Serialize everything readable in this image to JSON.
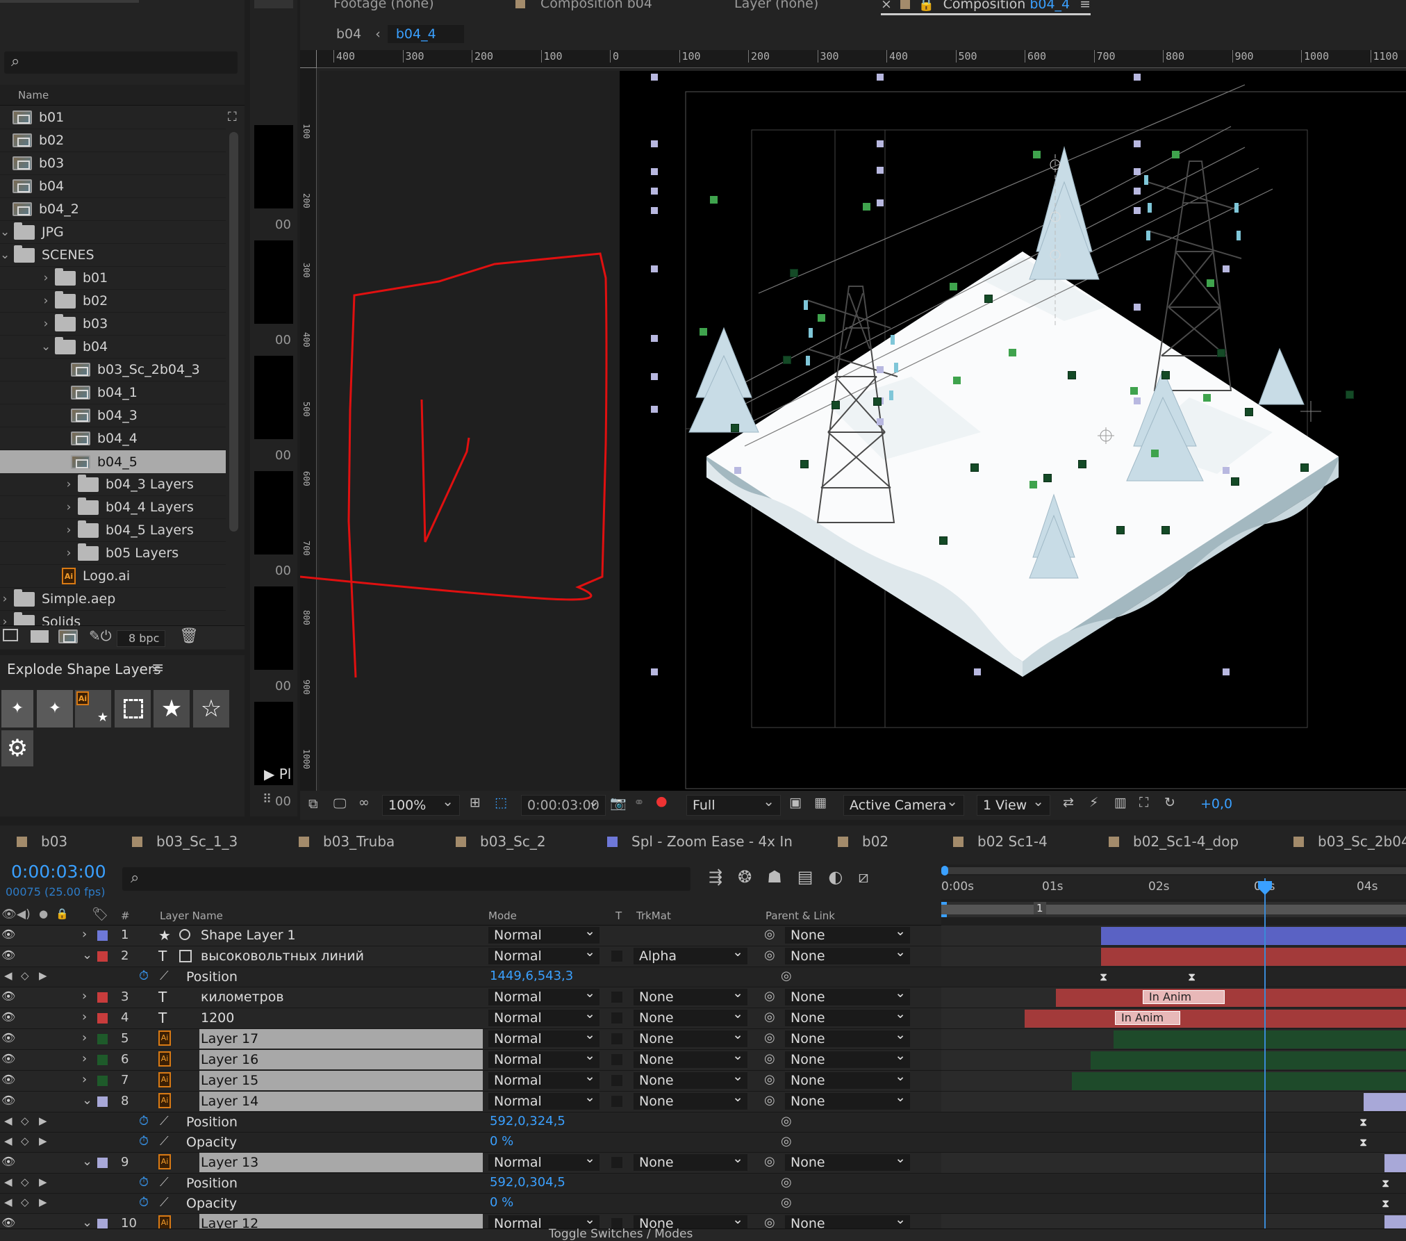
{
  "viewer_tabs": {
    "footage": "Footage (none)",
    "composition_prefix": "Composition",
    "composition_b04": "b04",
    "layer": "Layer (none)",
    "composition_active": "b04_4"
  },
  "breadcrumb": {
    "parent": "b04",
    "current": "b04_4"
  },
  "project": {
    "column_name": "Name",
    "items": [
      {
        "label": "b01",
        "type": "comp",
        "indent": 0
      },
      {
        "label": "b02",
        "type": "comp",
        "indent": 0
      },
      {
        "label": "b03",
        "type": "comp",
        "indent": 0
      },
      {
        "label": "b04",
        "type": "comp",
        "indent": 0
      },
      {
        "label": "b04_2",
        "type": "comp",
        "indent": 0
      },
      {
        "label": "JPG",
        "type": "folder",
        "indent": 0,
        "twirl": "⌄"
      },
      {
        "label": "SCENES",
        "type": "folder",
        "indent": 0,
        "twirl": "⌄"
      },
      {
        "label": "b01",
        "type": "folder",
        "indent": 1,
        "twirl": "›"
      },
      {
        "label": "b02",
        "type": "folder",
        "indent": 1,
        "twirl": "›"
      },
      {
        "label": "b03",
        "type": "folder",
        "indent": 1,
        "twirl": "›"
      },
      {
        "label": "b04",
        "type": "folder",
        "indent": 1,
        "twirl": "⌄"
      },
      {
        "label": "b03_Sc_2b04_3",
        "type": "comp",
        "indent": 2
      },
      {
        "label": "b04_1",
        "type": "comp",
        "indent": 2
      },
      {
        "label": "b04_3",
        "type": "comp",
        "indent": 2
      },
      {
        "label": "b04_4",
        "type": "comp",
        "indent": 2
      },
      {
        "label": "b04_5",
        "type": "comp",
        "indent": 2,
        "selected": true
      },
      {
        "label": "b04_3 Layers",
        "type": "folder",
        "indent": 2,
        "twirl": "›"
      },
      {
        "label": "b04_4 Layers",
        "type": "folder",
        "indent": 2,
        "twirl": "›"
      },
      {
        "label": "b04_5 Layers",
        "type": "folder",
        "indent": 2,
        "twirl": "›"
      },
      {
        "label": "b05 Layers",
        "type": "folder",
        "indent": 2,
        "twirl": "›"
      },
      {
        "label": "Logo.ai",
        "type": "ai",
        "indent": 1
      },
      {
        "label": "Simple.aep",
        "type": "folder",
        "indent": 0,
        "twirl": "›"
      },
      {
        "label": "Solids",
        "type": "folder",
        "indent": 0,
        "twirl": "›"
      }
    ],
    "bpc": "8 bpc"
  },
  "explode_panel": {
    "title": "Explode Shape Layers"
  },
  "ruler": {
    "h_labels": [
      "400",
      "300",
      "200",
      "100",
      "0",
      "100",
      "200",
      "300",
      "400",
      "500",
      "600",
      "700",
      "800",
      "900",
      "1000",
      "1100"
    ],
    "v_labels": [
      "100",
      "200",
      "300",
      "400",
      "500",
      "600",
      "700",
      "800",
      "900",
      "1000"
    ]
  },
  "left_strip": {
    "labels": [
      "00",
      "00",
      "00",
      "00",
      "00",
      "00"
    ],
    "play": "Pl"
  },
  "viewer_toolbar": {
    "zoom": "100%",
    "timecode": "0:00:03:00",
    "resolution": "Full",
    "camera": "Active Camera",
    "views": "1 View",
    "exposure": "+0,0"
  },
  "timeline_tabs": [
    {
      "label": "b03",
      "color": "#a38b6b"
    },
    {
      "label": "b03_Sc_1_3",
      "color": "#a38b6b"
    },
    {
      "label": "b03_Truba",
      "color": "#a38b6b"
    },
    {
      "label": "b03_Sc_2",
      "color": "#a38b6b"
    },
    {
      "label": "Spl - Zoom Ease - 4x In",
      "color": "#6e78d8"
    },
    {
      "label": "b02",
      "color": "#a38b6b"
    },
    {
      "label": "b02 Sc1-4",
      "color": "#a38b6b"
    },
    {
      "label": "b02_Sc1-4_dop",
      "color": "#a38b6b"
    },
    {
      "label": "b03_Sc_2b04",
      "color": "#a38b6b"
    }
  ],
  "timeline": {
    "current_time": "0:00:03:00",
    "frame_info": "00075 (25.00 fps)",
    "columns": {
      "layer_name": "Layer Name",
      "mode": "Mode",
      "t": "T",
      "trkmat": "TrkMat",
      "parent": "Parent & Link",
      "num": "#"
    },
    "ruler_labels": [
      "0:00s",
      "01s",
      "02s",
      "03s",
      "04s"
    ],
    "work_area_marker": "1",
    "toggle_label": "Toggle Switches / Modes",
    "rows": [
      {
        "kind": "layer",
        "num": "1",
        "name": "Shape Layer 1",
        "icon": "★",
        "label_color": "#6e78d8",
        "mode": "Normal",
        "trkmat": "",
        "parent": "None",
        "twirl": "›",
        "hl": false
      },
      {
        "kind": "layer",
        "num": "2",
        "name": "высоковольтных линий",
        "icon": "T",
        "label_color": "#c83c3c",
        "mode": "Normal",
        "trkmat": "Alpha",
        "parent": "None",
        "twirl": "⌄",
        "hl": false
      },
      {
        "kind": "prop",
        "name": "Position",
        "value": "1449,6,543,3"
      },
      {
        "kind": "layer",
        "num": "3",
        "name": "километров",
        "icon": "T",
        "label_color": "#c83c3c",
        "mode": "Normal",
        "trkmat": "None",
        "parent": "None",
        "twirl": "›",
        "hl": false
      },
      {
        "kind": "layer",
        "num": "4",
        "name": "1200",
        "icon": "T",
        "label_color": "#c83c3c",
        "mode": "Normal",
        "trkmat": "None",
        "parent": "None",
        "twirl": "›",
        "hl": false
      },
      {
        "kind": "layer",
        "num": "5",
        "name": "Layer 17",
        "icon": "Ai",
        "label_color": "#1e5a2a",
        "mode": "Normal",
        "trkmat": "None",
        "parent": "None",
        "twirl": "›",
        "hl": true
      },
      {
        "kind": "layer",
        "num": "6",
        "name": "Layer 16",
        "icon": "Ai",
        "label_color": "#1e5a2a",
        "mode": "Normal",
        "trkmat": "None",
        "parent": "None",
        "twirl": "›",
        "hl": true
      },
      {
        "kind": "layer",
        "num": "7",
        "name": "Layer 15",
        "icon": "Ai",
        "label_color": "#1e5a2a",
        "mode": "Normal",
        "trkmat": "None",
        "parent": "None",
        "twirl": "›",
        "hl": true
      },
      {
        "kind": "layer",
        "num": "8",
        "name": "Layer 14",
        "icon": "Ai",
        "label_color": "#a8a8d8",
        "mode": "Normal",
        "trkmat": "None",
        "parent": "None",
        "twirl": "⌄",
        "hl": true
      },
      {
        "kind": "prop",
        "name": "Position",
        "value": "592,0,324,5"
      },
      {
        "kind": "prop",
        "name": "Opacity",
        "value": "0 %"
      },
      {
        "kind": "layer",
        "num": "9",
        "name": "Layer 13",
        "icon": "Ai",
        "label_color": "#a8a8d8",
        "mode": "Normal",
        "trkmat": "None",
        "parent": "None",
        "twirl": "⌄",
        "hl": true
      },
      {
        "kind": "prop",
        "name": "Position",
        "value": "592,0,304,5"
      },
      {
        "kind": "prop",
        "name": "Opacity",
        "value": "0 %"
      },
      {
        "kind": "layer",
        "num": "10",
        "name": "Layer 12",
        "icon": "Ai",
        "label_color": "#a8a8d8",
        "mode": "Normal",
        "trkmat": "None",
        "parent": "None",
        "twirl": "⌄",
        "hl": true
      }
    ],
    "bar_labels": {
      "in_anim": "In Anim"
    }
  }
}
